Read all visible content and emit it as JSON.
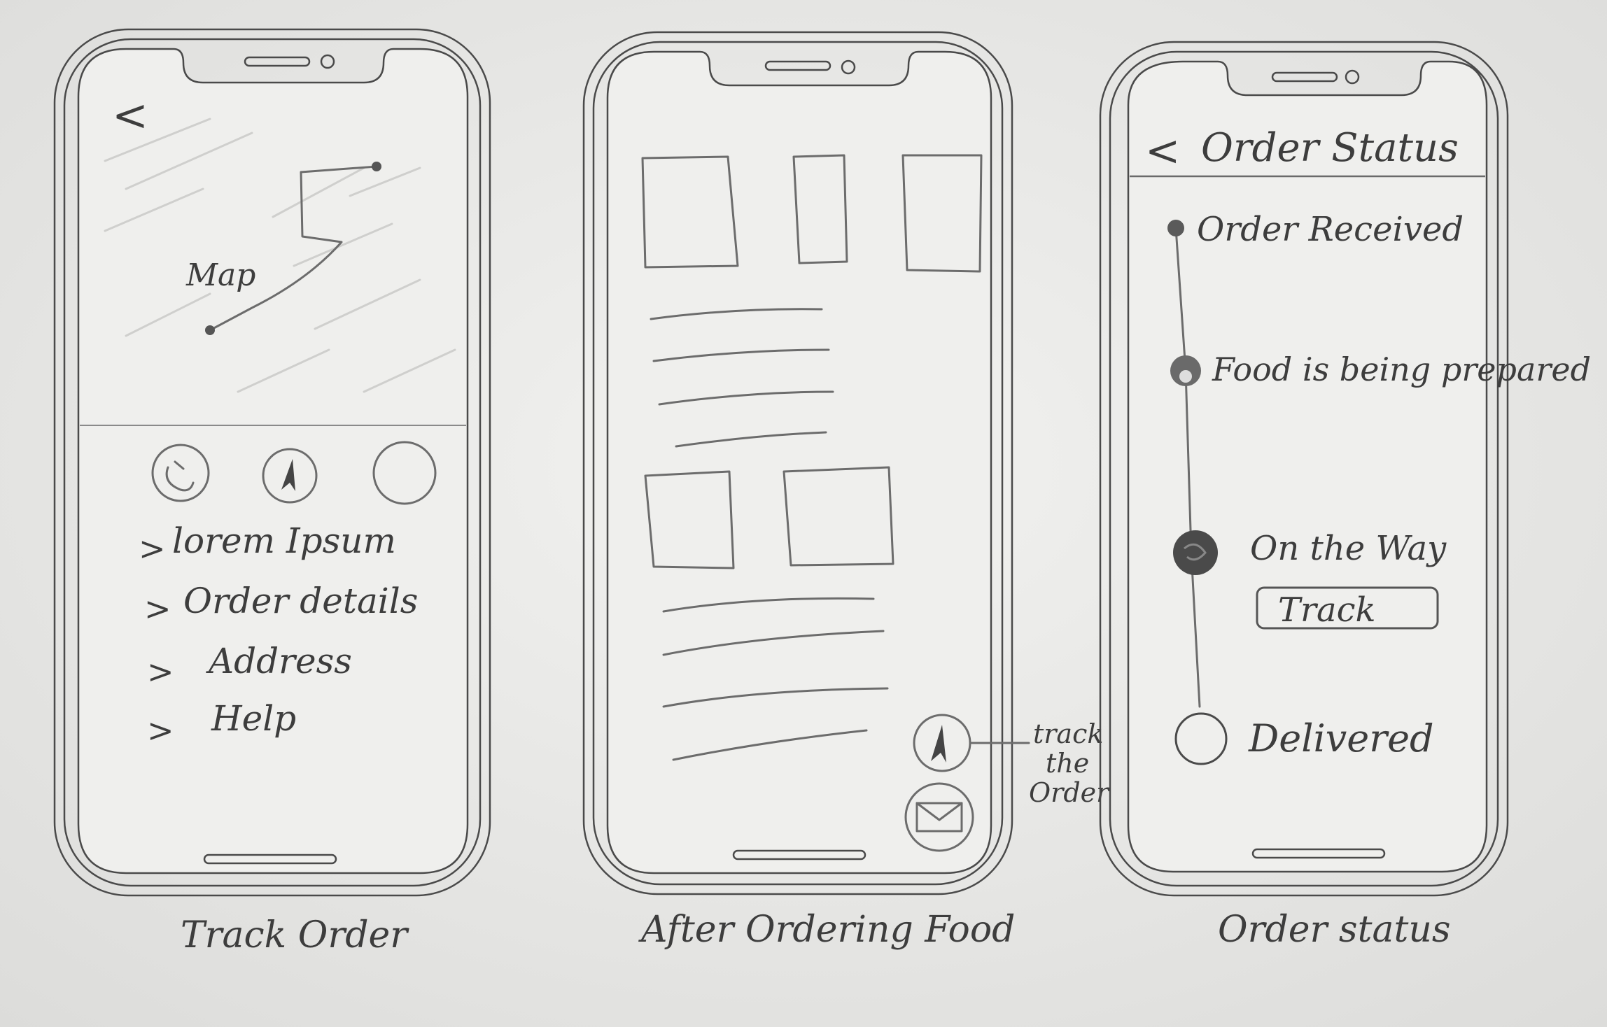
{
  "screens": {
    "track_order": {
      "caption": "Track Order",
      "back_glyph": "<",
      "map_label": "Map",
      "icons": [
        "phone-icon",
        "navigation-icon",
        "circle-icon"
      ],
      "menu": [
        {
          "chevron": ">",
          "label": "lorem Ipsum"
        },
        {
          "chevron": ">",
          "label": "Order details"
        },
        {
          "chevron": ">",
          "label": "Address"
        },
        {
          "chevron": ">",
          "label": "Help"
        }
      ]
    },
    "after_ordering": {
      "caption": "After Ordering Food",
      "annotation": [
        "track",
        "the",
        "Order"
      ],
      "icons": [
        "navigation-icon",
        "mail-icon"
      ]
    },
    "order_status": {
      "caption": "Order status",
      "back_glyph": "<",
      "title": "Order Status",
      "steps": [
        "Order Received",
        "Food is being prepared",
        "On the Way",
        "Delivered"
      ],
      "track_button": "Track"
    }
  }
}
